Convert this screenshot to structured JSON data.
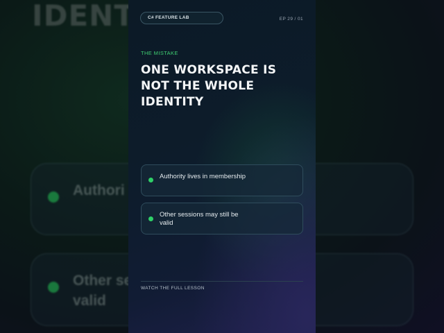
{
  "background": {
    "title_fragment": "IDENTI",
    "item_1_fragment": "Authori",
    "item_2_fragment": "Other se valid"
  },
  "card": {
    "series_badge": "C# FEATURE LAB",
    "episode": "EP 29 / 01",
    "kicker": "THE MISTAKE",
    "headline": "ONE WORKSPACE IS NOT THE WHOLE IDENTITY",
    "points": [
      {
        "text": "Authority lives in membership"
      },
      {
        "text": "Other sessions may still be valid"
      }
    ],
    "cta": "WATCH THE FULL LESSON"
  },
  "colors": {
    "accent_green": "#2fd068",
    "kicker_green": "#3fcf72",
    "card_dark": "#0d1c2b",
    "card_purple": "#1e1f4a"
  }
}
